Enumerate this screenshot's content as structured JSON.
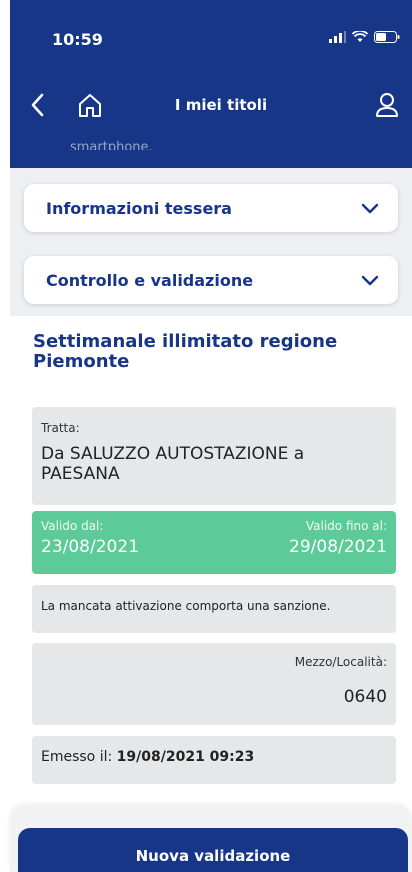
{
  "status_bar": {
    "time": "10:59"
  },
  "header": {
    "title": "I miei titoli",
    "cut_text": "smartphone."
  },
  "accordions": [
    {
      "label": "Informazioni tessera"
    },
    {
      "label": "Controllo e validazione"
    }
  ],
  "ticket": {
    "title": "Settimanale illimitato regione Piemonte",
    "tratta_label": "Tratta:",
    "tratta_value": "Da SALUZZO AUTOSTAZIONE a PAESANA",
    "valid_from_label": "Valido dal:",
    "valid_from": "23/08/2021",
    "valid_to_label": "Valido fino al:",
    "valid_to": "29/08/2021",
    "warning": "La mancata attivazione comporta una sanzione.",
    "mezzo_label": "Mezzo/Località:",
    "mezzo_value": "0640",
    "emesso_label": "Emesso il:",
    "emesso_value": "19/08/2021 09:23"
  },
  "actions": {
    "new_validation": "Nuova validazione"
  },
  "colors": {
    "primary": "#173688",
    "valid": "#5ccb99",
    "card": "#e6e7e8"
  }
}
